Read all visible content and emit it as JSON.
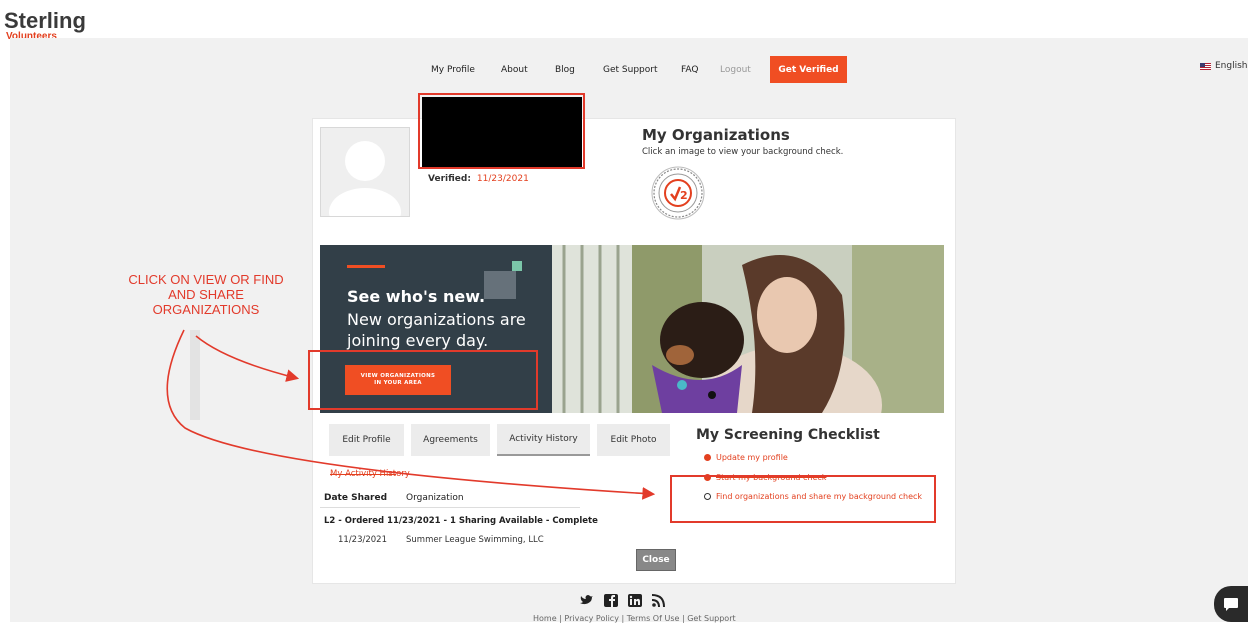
{
  "brand": {
    "name": "Sterling",
    "sub": "Volunteers"
  },
  "nav": {
    "items": [
      "My Profile",
      "About",
      "Blog",
      "Get Support",
      "FAQ",
      "Logout"
    ],
    "cta": "Get Verified",
    "language": "English"
  },
  "profile": {
    "verified_label": "Verified:",
    "verified_date": "11/23/2021"
  },
  "orgs": {
    "title": "My Organizations",
    "subtitle": "Click an image to view your background check."
  },
  "banner": {
    "headline": "See who's new.",
    "text": "New organizations are joining every day.",
    "button_line1": "VIEW ORGANIZATIONS",
    "button_line2": "IN YOUR AREA"
  },
  "tabs": [
    "Edit Profile",
    "Agreements",
    "Activity History",
    "Edit Photo"
  ],
  "activity": {
    "title": "My Activity History",
    "headers": [
      "Date Shared",
      "Organization"
    ],
    "summary": "L2 - Ordered 11/23/2021 - 1 Sharing Available - Complete",
    "rows": [
      {
        "date": "11/23/2021",
        "org": "Summer League Swimming, LLC"
      }
    ],
    "close_label": "Close"
  },
  "checklist": {
    "title": "My Screening Checklist",
    "items": [
      "Update my profile",
      "Start my background check",
      "Find organizations and share my background check"
    ]
  },
  "annotation": "CLICK ON VIEW OR FIND AND SHARE ORGANIZATIONS",
  "footer": {
    "links": "Home | Privacy Policy | Terms Of Use | Get Support"
  },
  "colors": {
    "accent": "#f04e23",
    "annotation": "#e23a2b",
    "banner_dark": "#323f48"
  }
}
